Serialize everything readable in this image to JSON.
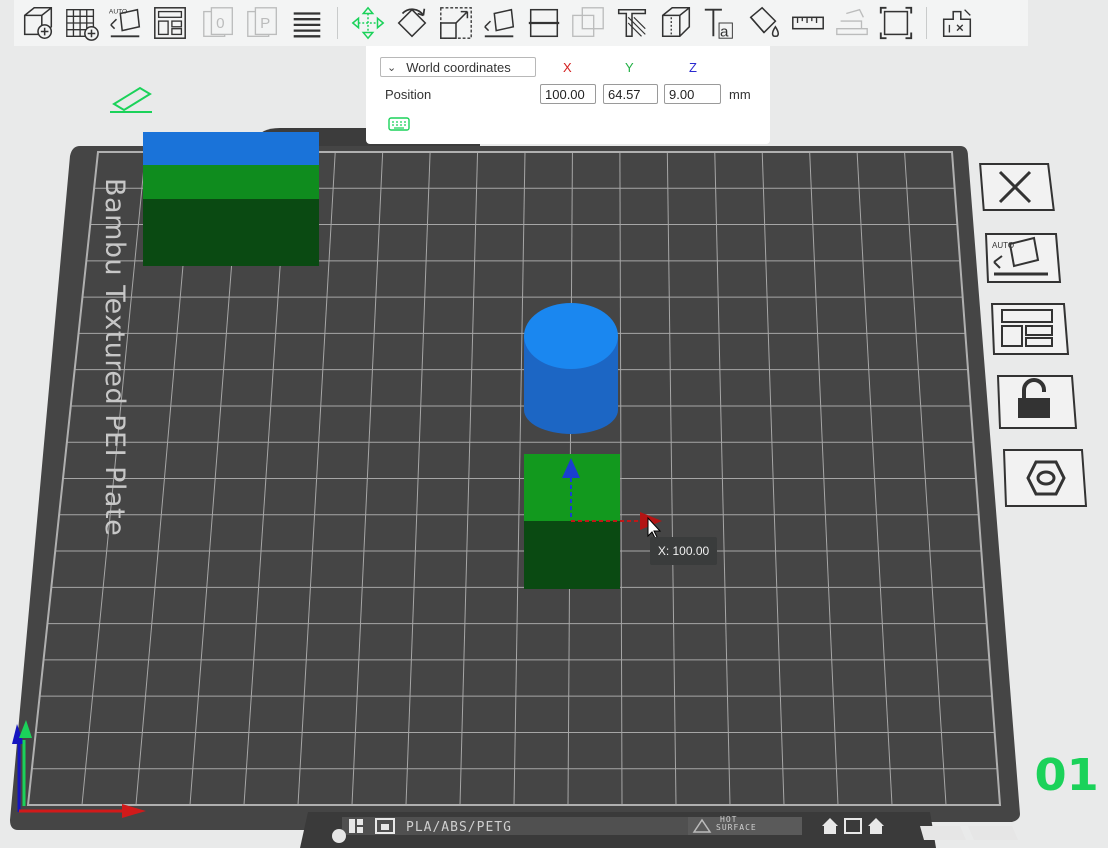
{
  "toolbar": {
    "items": [
      {
        "name": "add-cube",
        "label": "Add"
      },
      {
        "name": "add-plate",
        "label": "Add plate"
      },
      {
        "name": "auto-orient",
        "label": "AUTO"
      },
      {
        "name": "arrange",
        "label": "Arrange"
      },
      {
        "name": "split-objects",
        "label": "O",
        "disabled": true
      },
      {
        "name": "split-parts",
        "label": "P",
        "disabled": true
      },
      {
        "name": "layers",
        "label": "Layers"
      },
      {
        "name": "move",
        "label": "Move"
      },
      {
        "name": "rotate",
        "label": "Rotate"
      },
      {
        "name": "scale",
        "label": "Scale"
      },
      {
        "name": "lay-on-face",
        "label": "Lay on face"
      },
      {
        "name": "cut",
        "label": "Cut"
      },
      {
        "name": "boolean",
        "label": "Boolean",
        "disabled": true
      },
      {
        "name": "support-paint",
        "label": "Support painting"
      },
      {
        "name": "seam-paint",
        "label": "Seam painting"
      },
      {
        "name": "text",
        "label": "Ta"
      },
      {
        "name": "color-paint",
        "label": "Color painting"
      },
      {
        "name": "measure",
        "label": "Measure"
      },
      {
        "name": "assembly",
        "label": "Assembly",
        "disabled": true
      },
      {
        "name": "fit-view",
        "label": "Fit"
      },
      {
        "name": "variable-layer",
        "label": "Variable layer"
      }
    ]
  },
  "position_panel": {
    "coord_system": "World coordinates",
    "axes": {
      "x": "X",
      "y": "Y",
      "z": "Z"
    },
    "position_label": "Position",
    "x": "100.00",
    "y": "64.57",
    "z": "9.00",
    "unit": "mm"
  },
  "viewport": {
    "tooltip": "X: 100.00",
    "bed_label": "Bambu Textured PEI Plate",
    "filament_label": "PLA/ABS/PETG",
    "hot_surface_line1": "HOT",
    "hot_surface_line2": "SURFACE",
    "plate_number": "01"
  },
  "colors": {
    "bed": "#454545",
    "grid": "#a0a0a0",
    "accent_green": "#1bd25a",
    "object_blue": "#1a73d9",
    "object_green": "#0f8c1e",
    "object_dark_green": "#0a4a12"
  }
}
